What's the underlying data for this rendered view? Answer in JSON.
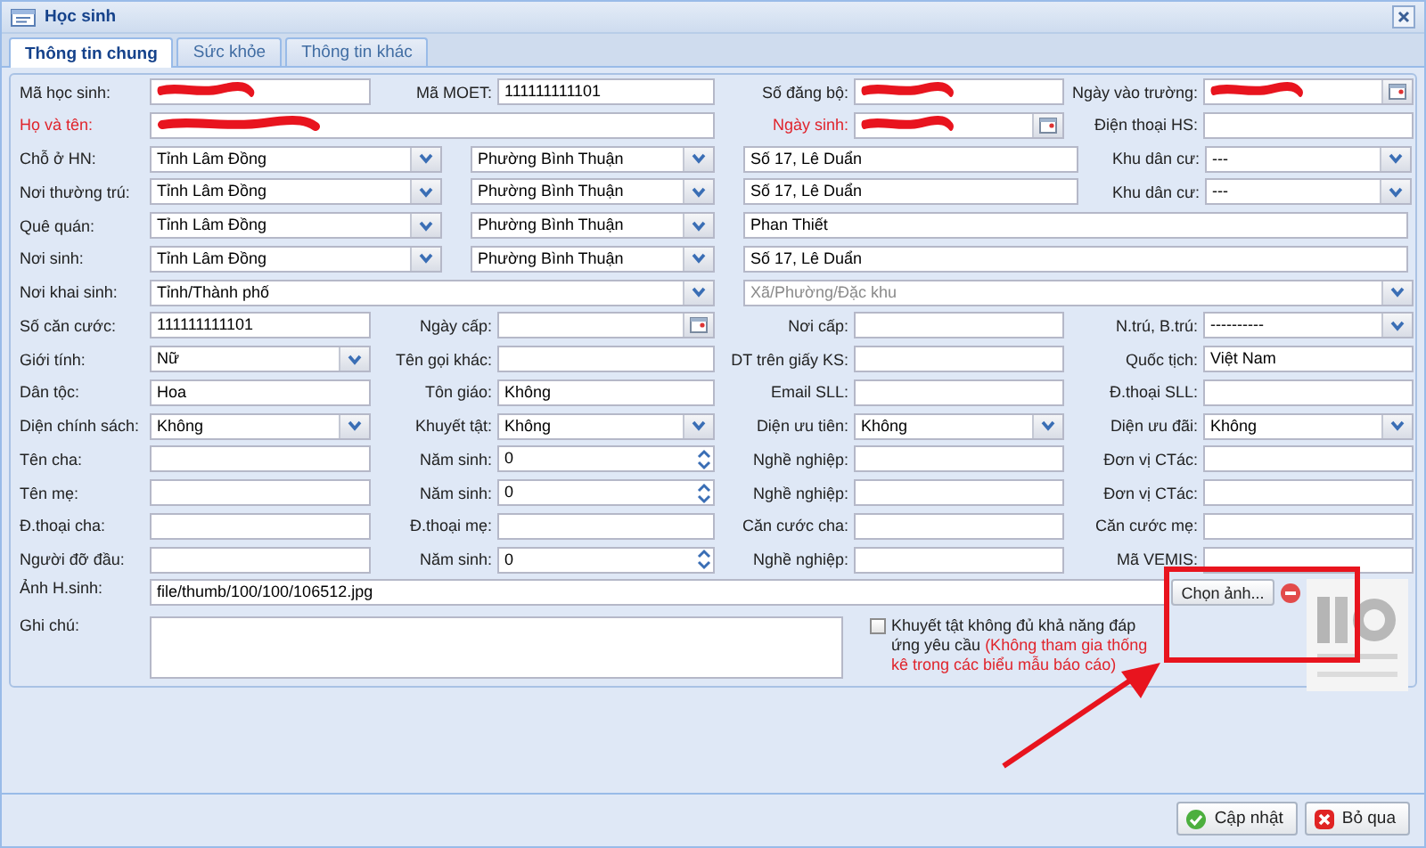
{
  "window": {
    "title": "Học sinh"
  },
  "tabs": [
    {
      "label": "Thông tin chung",
      "selected": true
    },
    {
      "label": "Sức khỏe",
      "selected": false
    },
    {
      "label": "Thông tin khác",
      "selected": false
    }
  ],
  "rows": [
    {
      "kind": "std",
      "cells": [
        {
          "label": "Mã học sinh:",
          "required": false,
          "kind": "text",
          "redacted": true
        },
        {
          "label": "Mã MOET:",
          "required": false,
          "kind": "text",
          "value": "111111111101",
          "redacted": false
        },
        {
          "label": "Số đăng bộ:",
          "required": false,
          "kind": "text",
          "redacted": true
        },
        {
          "label": "Ngày vào trường:",
          "required": false,
          "kind": "date",
          "redacted": true
        }
      ]
    },
    {
      "kind": "name",
      "cells": [
        {
          "label": "Họ và tên:",
          "required": true,
          "kind": "text",
          "redacted": true
        },
        {
          "label": "Ngày sinh:",
          "required": true,
          "kind": "date",
          "redacted": true
        },
        {
          "label": "Điện thoại HS:",
          "required": false,
          "kind": "text",
          "redacted": false
        }
      ]
    },
    {
      "kind": "address",
      "cells": [
        {
          "label": "Chỗ ở HN:",
          "required": false,
          "kind": "select",
          "value": "Tỉnh Lâm Đồng",
          "redacted": false
        },
        {
          "kind": "select",
          "value": "Phường Bình Thuận",
          "redacted": false
        },
        {
          "kind": "text",
          "value": "Số 17, Lê Duẩn",
          "redacted": false
        },
        {
          "label": "Khu dân cư:",
          "required": false,
          "kind": "select",
          "value": "---",
          "redacted": false
        }
      ]
    },
    {
      "kind": "address",
      "cells": [
        {
          "label": "Nơi thường trú:",
          "required": false,
          "kind": "select",
          "value": "Tỉnh Lâm Đồng",
          "redacted": false
        },
        {
          "kind": "select",
          "value": "Phường Bình Thuận",
          "redacted": false
        },
        {
          "kind": "text",
          "value": "Số 17, Lê Duẩn",
          "redacted": false
        },
        {
          "label": "Khu dân cư:",
          "required": false,
          "kind": "select",
          "value": "---",
          "redacted": false
        }
      ]
    },
    {
      "kind": "address_wide",
      "cells": [
        {
          "label": "Quê quán:",
          "required": false,
          "kind": "select",
          "value": "Tỉnh Lâm Đồng",
          "redacted": false
        },
        {
          "kind": "select",
          "value": "Phường Bình Thuận",
          "redacted": false
        },
        {
          "kind": "text",
          "value": "Phan Thiết",
          "redacted": false
        }
      ]
    },
    {
      "kind": "address_wide",
      "cells": [
        {
          "label": "Nơi sinh:",
          "required": false,
          "kind": "select",
          "value": "Tỉnh Lâm Đồng",
          "redacted": false
        },
        {
          "kind": "select",
          "value": "Phường Bình Thuận",
          "redacted": false
        },
        {
          "kind": "text",
          "value": "Số 17, Lê Duẩn",
          "redacted": false
        }
      ]
    },
    {
      "kind": "birthplace",
      "cells": [
        {
          "label": "Nơi khai sinh:",
          "required": false,
          "kind": "select",
          "value": "Tỉnh/Thành phố",
          "redacted": false
        },
        {
          "kind": "select",
          "placeholder": "Xã/Phường/Đặc khu",
          "redacted": false
        }
      ]
    },
    {
      "kind": "std",
      "cells": [
        {
          "label": "Số căn cước:",
          "required": false,
          "kind": "text",
          "value": "111111111101",
          "redacted": false
        },
        {
          "label": "Ngày cấp:",
          "required": false,
          "kind": "date",
          "redacted": false
        },
        {
          "label": "Nơi cấp:",
          "required": false,
          "kind": "text",
          "redacted": false
        },
        {
          "label": "N.trú, B.trú:",
          "required": false,
          "kind": "select",
          "value": "----------",
          "redacted": false
        }
      ]
    },
    {
      "kind": "std",
      "cells": [
        {
          "label": "Giới tính:",
          "required": false,
          "kind": "select",
          "value": "Nữ",
          "redacted": false
        },
        {
          "label": "Tên gọi khác:",
          "required": false,
          "kind": "text",
          "redacted": false
        },
        {
          "label": "DT trên giấy KS:",
          "required": false,
          "kind": "text",
          "redacted": false
        },
        {
          "label": "Quốc tịch:",
          "required": false,
          "kind": "text",
          "value": "Việt Nam",
          "redacted": false
        }
      ]
    },
    {
      "kind": "std",
      "cells": [
        {
          "label": "Dân tộc:",
          "required": false,
          "kind": "text",
          "value": "Hoa",
          "redacted": false
        },
        {
          "label": "Tôn giáo:",
          "required": false,
          "kind": "text",
          "value": "Không",
          "redacted": false
        },
        {
          "label": "Email SLL:",
          "required": false,
          "kind": "text",
          "redacted": false
        },
        {
          "label": "Đ.thoại SLL:",
          "required": false,
          "kind": "text",
          "redacted": false
        }
      ]
    },
    {
      "kind": "std",
      "cells": [
        {
          "label": "Diện chính sách:",
          "required": false,
          "kind": "select",
          "value": "Không",
          "redacted": false
        },
        {
          "label": "Khuyết tật:",
          "required": false,
          "kind": "select",
          "value": "Không",
          "redacted": false
        },
        {
          "label": "Diện ưu tiên:",
          "required": false,
          "kind": "select",
          "value": "Không",
          "redacted": false
        },
        {
          "label": "Diện ưu đãi:",
          "required": false,
          "kind": "select",
          "value": "Không",
          "redacted": false
        }
      ]
    },
    {
      "kind": "std",
      "cells": [
        {
          "label": "Tên cha:",
          "required": false,
          "kind": "text",
          "redacted": false
        },
        {
          "label": "Năm sinh:",
          "required": false,
          "kind": "spin",
          "value": "0",
          "redacted": false
        },
        {
          "label": "Nghề nghiệp:",
          "required": false,
          "kind": "text",
          "redacted": false
        },
        {
          "label": "Đơn vị CTác:",
          "required": false,
          "kind": "text",
          "redacted": false
        }
      ]
    },
    {
      "kind": "std",
      "cells": [
        {
          "label": "Tên mẹ:",
          "required": false,
          "kind": "text",
          "redacted": false
        },
        {
          "label": "Năm sinh:",
          "required": false,
          "kind": "spin",
          "value": "0",
          "redacted": false
        },
        {
          "label": "Nghề nghiệp:",
          "required": false,
          "kind": "text",
          "redacted": false
        },
        {
          "label": "Đơn vị CTác:",
          "required": false,
          "kind": "text",
          "redacted": false
        }
      ]
    },
    {
      "kind": "std",
      "cells": [
        {
          "label": "Đ.thoại cha:",
          "required": false,
          "kind": "text",
          "redacted": false
        },
        {
          "label": "Đ.thoại mẹ:",
          "required": false,
          "kind": "text",
          "redacted": false
        },
        {
          "label": "Căn cước cha:",
          "required": false,
          "kind": "text",
          "redacted": false
        },
        {
          "label": "Căn cước mẹ:",
          "required": false,
          "kind": "text",
          "redacted": false
        }
      ]
    },
    {
      "kind": "std",
      "cells": [
        {
          "label": "Người đỡ đầu:",
          "required": false,
          "kind": "text",
          "redacted": false
        },
        {
          "label": "Năm sinh:",
          "required": false,
          "kind": "spin",
          "value": "0",
          "redacted": false
        },
        {
          "label": "Nghề nghiệp:",
          "required": false,
          "kind": "text",
          "redacted": false
        },
        {
          "label": "Mã VEMIS:",
          "required": false,
          "kind": "text",
          "redacted": false
        }
      ]
    }
  ],
  "photo": {
    "label": "Ảnh H.sinh:",
    "value": "file/thumb/100/100/106512.jpg",
    "choose_button": "Chọn ảnh..."
  },
  "note": {
    "label": "Ghi chú:"
  },
  "checkbox": {
    "label": "Khuyết tật không đủ khả năng đáp ứng yêu cầu",
    "note": "(Không tham gia thống kê trong các biểu mẫu báo cáo)",
    "checked": false
  },
  "footer_buttons": [
    {
      "label": "Cập nhật",
      "kind": "save"
    },
    {
      "label": "Bỏ qua",
      "kind": "cancel"
    }
  ],
  "annotations": {
    "highlight_box": true,
    "arrow": true
  }
}
